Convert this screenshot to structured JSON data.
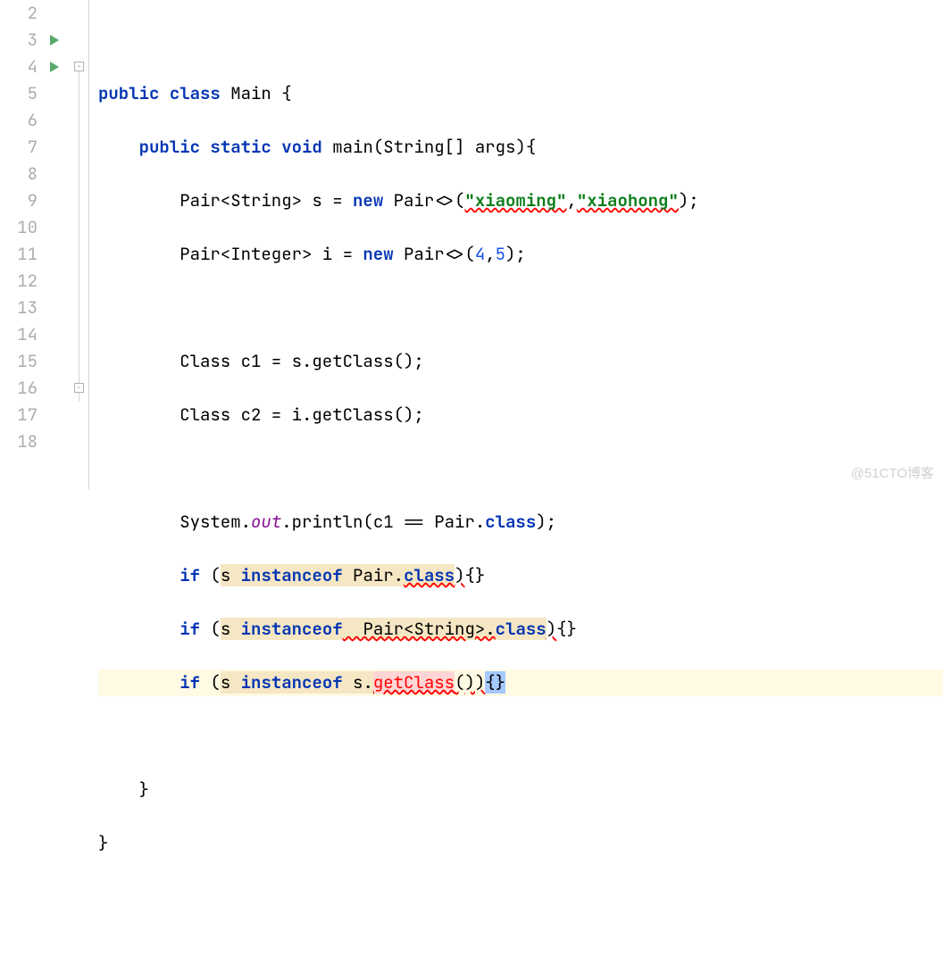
{
  "watermark": "@51CTO博客",
  "gutter": {
    "start": 2,
    "end": 18
  },
  "icons": {
    "run_lines": [
      3,
      4
    ]
  },
  "fold": {
    "open_at": 4,
    "close_at": 16,
    "line_from": 4,
    "line_to": 16
  },
  "highlight_line": 14,
  "code": {
    "l3": {
      "kw1": "public",
      "kw2": "class",
      "name": " Main {"
    },
    "l4": {
      "kw1": "public",
      "kw2": "static",
      "kw3": "void",
      "rest": " main(String[] args){"
    },
    "l5": {
      "pre": "Pair<String> s = ",
      "kw": "new",
      "mid": " Pair<>(",
      "s1": "\"xiaoming\"",
      "comma": ",",
      "s2": "\"xiaohong\"",
      "end": ");"
    },
    "l6": {
      "pre": "Pair<Integer> i = ",
      "kw": "new",
      "mid": " Pair<>(",
      "n1": "4",
      "comma": ",",
      "n2": "5",
      "end": ");"
    },
    "l8": {
      "text": "Class c1 = s.getClass();"
    },
    "l9": {
      "text": "Class c2 = i.getClass();"
    },
    "l11": {
      "pre": "System.",
      "out": "out",
      "mid": ".println(c1 == Pair.",
      "kw": "class",
      "end": ");"
    },
    "l12": {
      "kw1": "if",
      "p1": " (",
      "s": "s ",
      "kw2": "instanceof",
      "mid": " Pair.",
      "cls": "class",
      "close": ")",
      "br": "{}"
    },
    "l13": {
      "kw1": "if",
      "p1": " (",
      "s": "s ",
      "kw2": "instanceof",
      "mid": "  Pair<String>.",
      "cls": "class",
      "close": ")",
      "br": "{}"
    },
    "l14": {
      "kw1": "if",
      "p1": " (",
      "s": "s ",
      "kw2": "instanceof",
      "mid": " s.",
      "call": "getClass",
      "paren": "()",
      "close": ")",
      "br": "{}"
    },
    "l16": {
      "text": "}"
    },
    "l17": {
      "text": "}"
    }
  }
}
